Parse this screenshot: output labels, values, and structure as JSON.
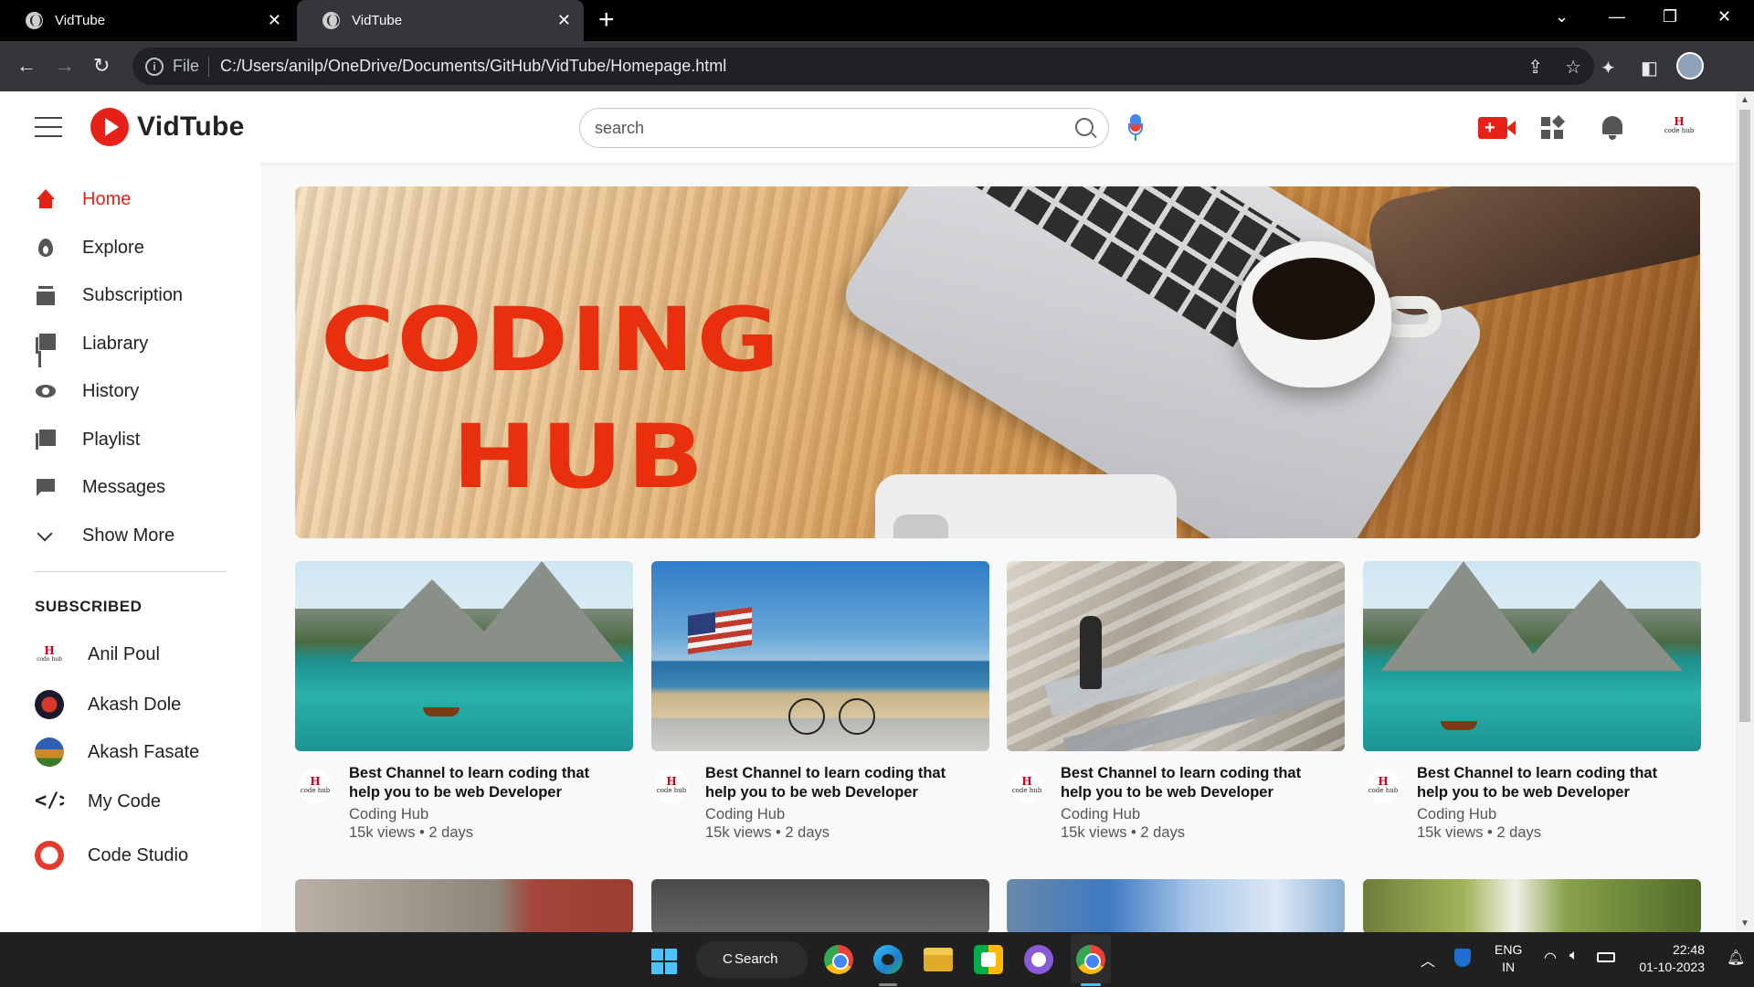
{
  "browser": {
    "tabs": [
      {
        "title": "VidTube",
        "active": false
      },
      {
        "title": "VidTube",
        "active": true
      }
    ],
    "address": {
      "scheme": "File",
      "url": "C:/Users/anilp/OneDrive/Documents/GitHub/VidTube/Homepage.html"
    }
  },
  "app": {
    "name": "VidTube",
    "search_placeholder": "search",
    "channel_logo": {
      "mark": "H",
      "text": "code hub"
    }
  },
  "sidebar": {
    "items": [
      {
        "label": "Home",
        "icon": "home-icon",
        "active": true
      },
      {
        "label": "Explore",
        "icon": "explore-icon"
      },
      {
        "label": "Subscription",
        "icon": "subscription-icon"
      },
      {
        "label": "Liabrary",
        "icon": "library-icon"
      },
      {
        "label": "History",
        "icon": "history-icon"
      },
      {
        "label": "Playlist",
        "icon": "playlist-icon"
      },
      {
        "label": "Messages",
        "icon": "messages-icon"
      },
      {
        "label": "Show More",
        "icon": "chevron-down-icon"
      }
    ],
    "subscribed_heading": "SUBSCRIBED",
    "subscriptions": [
      {
        "name": "Anil Poul"
      },
      {
        "name": "Akash Dole"
      },
      {
        "name": "Akash Fasate"
      },
      {
        "name": "My Code"
      },
      {
        "name": "Code Studio"
      }
    ]
  },
  "banner": {
    "line1": "CODING",
    "line2": "HUB"
  },
  "videos": [
    {
      "title": "Best Channel to learn coding that help you to be web Developer",
      "channel": "Coding Hub",
      "stats": "15k views • 2 days"
    },
    {
      "title": "Best Channel to learn coding that help you to be web Developer",
      "channel": "Coding Hub",
      "stats": "15k views • 2 days"
    },
    {
      "title": "Best Channel to learn coding that help you to be web Developer",
      "channel": "Coding Hub",
      "stats": "15k views • 2 days"
    },
    {
      "title": "Best Channel to learn coding that help you to be web Developer",
      "channel": "Coding Hub",
      "stats": "15k views • 2 days"
    }
  ],
  "taskbar": {
    "search_label": "Search",
    "language": "ENG",
    "region": "IN",
    "time": "22:48",
    "date": "01-10-2023"
  },
  "colors": {
    "brand_red": "#e62117",
    "banner_text": "#e8300f",
    "chrome_dark": "#35363a"
  }
}
